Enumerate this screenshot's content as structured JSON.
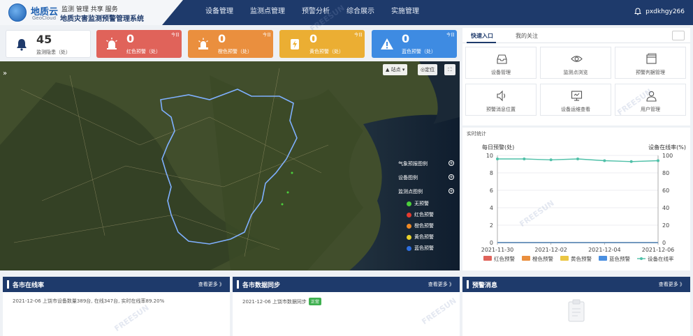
{
  "header": {
    "logo_cn": "地质云",
    "logo_en": "GeoCloud",
    "slogan": "监测 管理 共享 服务",
    "system_title": "地质灾害监测预警管理系统",
    "nav": [
      "设备管理",
      "监测点管理",
      "预警分析",
      "综合展示",
      "实施管理"
    ],
    "username": "pxdkhgy266"
  },
  "stats": [
    {
      "value": "45",
      "label": "监测隐患（处）",
      "today": ""
    },
    {
      "value": "0",
      "label": "红色预警（处）",
      "today": "今日"
    },
    {
      "value": "0",
      "label": "橙色预警（处）",
      "today": "今日"
    },
    {
      "value": "0",
      "label": "黄色预警（处）",
      "today": "今日"
    },
    {
      "value": "0",
      "label": "蓝色预警（处）",
      "today": "今日"
    }
  ],
  "map": {
    "station_btn": "站点",
    "locate_btn": "定位",
    "legend_headers": [
      "气象预报图例",
      "设备图例",
      "监测点图例"
    ],
    "legend_items": [
      {
        "label": "无预警",
        "color": "#4cd03c"
      },
      {
        "label": "红色预警",
        "color": "#e53a2f"
      },
      {
        "label": "橙色预警",
        "color": "#f08a24"
      },
      {
        "label": "黄色预警",
        "color": "#e8d12a"
      },
      {
        "label": "蓝色预警",
        "color": "#2d6fe0"
      }
    ]
  },
  "quick": {
    "tabs": [
      "快速入口",
      "我的关注"
    ],
    "links": [
      "设备管理",
      "监测点浏览",
      "预警判据管理",
      "预警消息位置",
      "设备运维查看",
      "用户管理"
    ]
  },
  "stats_panel": {
    "title": "实时统计"
  },
  "chart_data": {
    "type": "line",
    "title": "",
    "ylabel_left": "每日预警(处)",
    "ylabel_right": "设备在线率(%)",
    "x": [
      "2021-11-30",
      "2021-12-01",
      "2021-12-02",
      "2021-12-03",
      "2021-12-04",
      "2021-12-05",
      "2021-12-06"
    ],
    "x_tick_labels": [
      "2021-11-30",
      "2021-12-02",
      "2021-12-04",
      "2021-12-06"
    ],
    "ylim_left": [
      0,
      10
    ],
    "ylim_right": [
      0,
      100
    ],
    "left_ticks": [
      0,
      2,
      4,
      6,
      8,
      10
    ],
    "right_ticks": [
      0,
      20,
      40,
      60,
      80,
      100
    ],
    "series": [
      {
        "name": "红色预警",
        "color": "#e0635a",
        "axis": "left",
        "values": [
          0,
          0,
          0,
          0,
          0,
          0,
          0
        ]
      },
      {
        "name": "橙色预警",
        "color": "#ea8f3e",
        "axis": "left",
        "values": [
          0,
          0,
          0,
          0,
          0,
          0,
          0
        ]
      },
      {
        "name": "黄色预警",
        "color": "#ebc643",
        "axis": "left",
        "values": [
          0,
          0,
          0,
          0,
          0,
          0,
          0
        ]
      },
      {
        "name": "蓝色预警",
        "color": "#4a8fe0",
        "axis": "left",
        "values": [
          0,
          0,
          0,
          0,
          0,
          0,
          0
        ]
      },
      {
        "name": "设备在线率",
        "color": "#4fc0a8",
        "axis": "right",
        "values": [
          96,
          96,
          95,
          96,
          94,
          93,
          94
        ]
      }
    ],
    "grid": true,
    "legend": "bottom"
  },
  "panels": [
    {
      "title": "各市在线率",
      "more": "查看更多 》",
      "line": "2021-12-06 上饶市设备数量389台, 在线347台, 实时在线率89.20%",
      "badge": ""
    },
    {
      "title": "各市数据同步",
      "more": "查看更多 》",
      "line": "2021-12-06 上饶市数据同步",
      "badge": "正常"
    },
    {
      "title": "预警消息",
      "more": "查看更多 》",
      "line": "",
      "badge": ""
    }
  ]
}
